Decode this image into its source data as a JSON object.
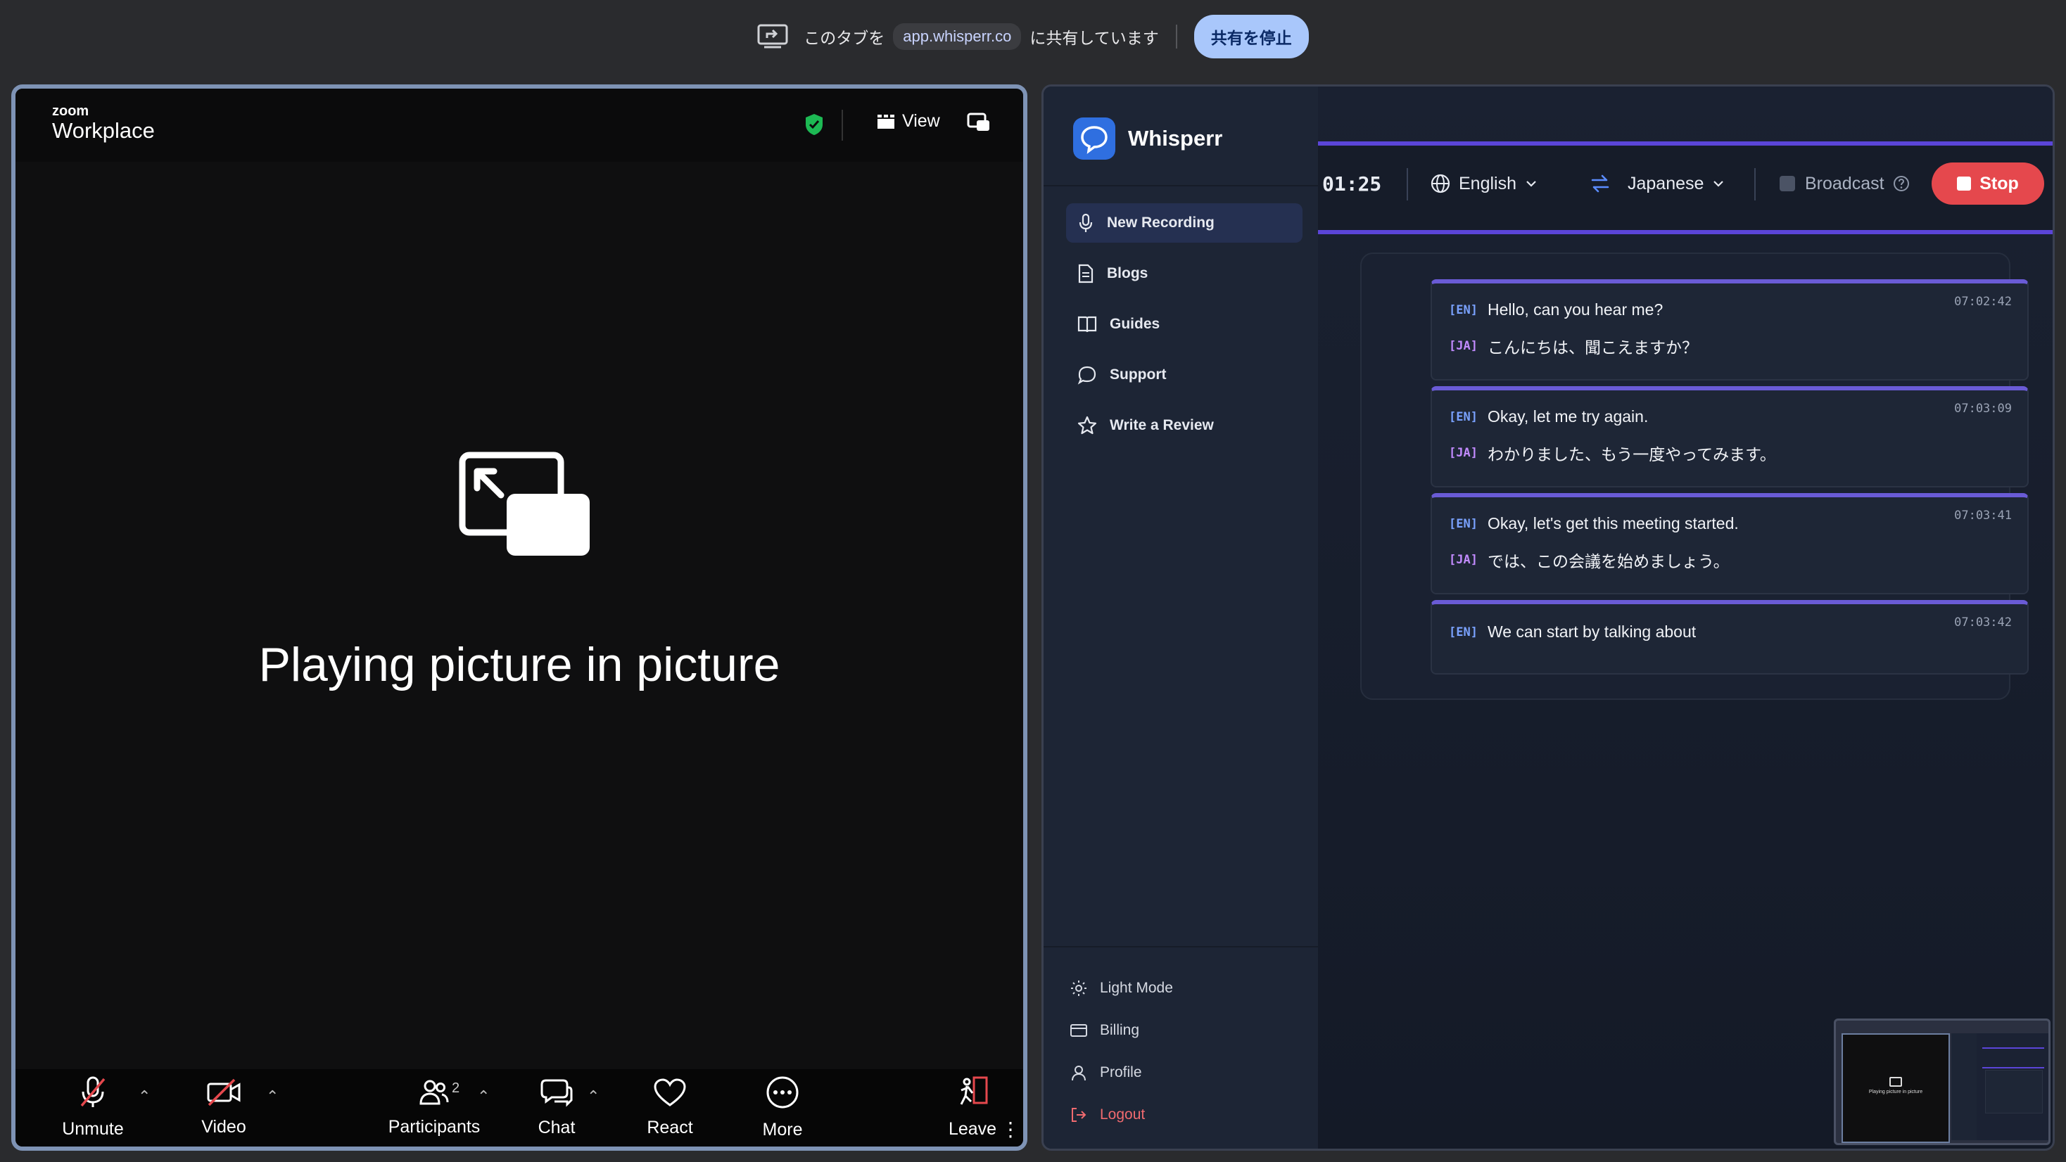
{
  "share_bar": {
    "text_before": "このタブを",
    "domain": "app.whisperr.co",
    "text_after": "に共有しています",
    "stop_button": "共有を停止"
  },
  "zoom": {
    "logo_small": "zoom",
    "logo_large": "Workplace",
    "view_label": "View",
    "pip_message": "Playing picture in picture",
    "toolbar": {
      "unmute": "Unmute",
      "video": "Video",
      "participants": "Participants",
      "participants_count": "2",
      "chat": "Chat",
      "react": "React",
      "more": "More",
      "leave": "Leave"
    }
  },
  "whisperr": {
    "brand": "Whisperr",
    "nav": [
      {
        "label": "New Recording",
        "icon": "microphone-icon",
        "active": true
      },
      {
        "label": "Blogs",
        "icon": "document-icon"
      },
      {
        "label": "Guides",
        "icon": "book-icon"
      },
      {
        "label": "Support",
        "icon": "chat-bubble-icon"
      },
      {
        "label": "Write a Review",
        "icon": "star-icon"
      }
    ],
    "bottom_nav": [
      {
        "label": "Light Mode",
        "icon": "sun-icon"
      },
      {
        "label": "Billing",
        "icon": "card-icon"
      },
      {
        "label": "Profile",
        "icon": "user-icon"
      },
      {
        "label": "Logout",
        "icon": "logout-icon"
      }
    ],
    "recording": {
      "timer": "01:25",
      "source_language": "English",
      "target_language": "Japanese",
      "broadcast_label": "Broadcast",
      "stop_label": "Stop"
    },
    "transcripts": [
      {
        "time": "07:02:42",
        "en_tag": "[EN]",
        "en": "Hello, can you hear me?",
        "ja_tag": "[JA]",
        "ja": "こんにちは、聞こえますか？"
      },
      {
        "time": "07:03:09",
        "en_tag": "[EN]",
        "en": "Okay, let me try again.",
        "ja_tag": "[JA]",
        "ja": "わかりました、もう一度やってみます。"
      },
      {
        "time": "07:03:41",
        "en_tag": "[EN]",
        "en": "Okay, let's get this meeting started.",
        "ja_tag": "[JA]",
        "ja": "では、この会議を始めましょう。"
      },
      {
        "time": "07:03:42",
        "en_tag": "[EN]",
        "en": "We can start by talking about"
      }
    ],
    "pip_thumbnail_text": "Playing picture in picture"
  },
  "colors": {
    "accent": "#6a5bd6",
    "stop": "#e5484d",
    "en_tag": "#7aa2ff",
    "ja_tag": "#c28bff"
  }
}
